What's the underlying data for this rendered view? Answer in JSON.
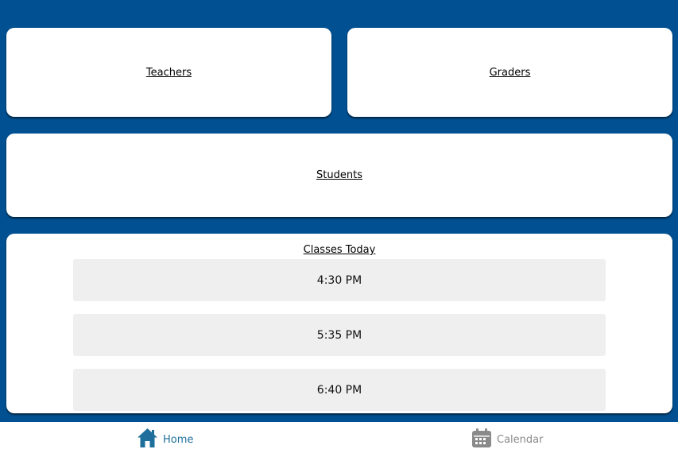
{
  "cards": {
    "teachers": "Teachers",
    "graders": "Graders",
    "students": "Students"
  },
  "classes": {
    "title": "Classes Today",
    "items": [
      {
        "time": "4:30 PM"
      },
      {
        "time": "5:35 PM"
      },
      {
        "time": "6:40 PM"
      }
    ]
  },
  "nav": {
    "home": {
      "label": "Home",
      "icon": "home-icon",
      "active": true
    },
    "calendar": {
      "label": "Calendar",
      "icon": "calendar-icon",
      "active": false
    }
  },
  "colors": {
    "background": "#015092",
    "active_nav": "#1f6f9c",
    "inactive_nav": "#8a8a8a"
  }
}
